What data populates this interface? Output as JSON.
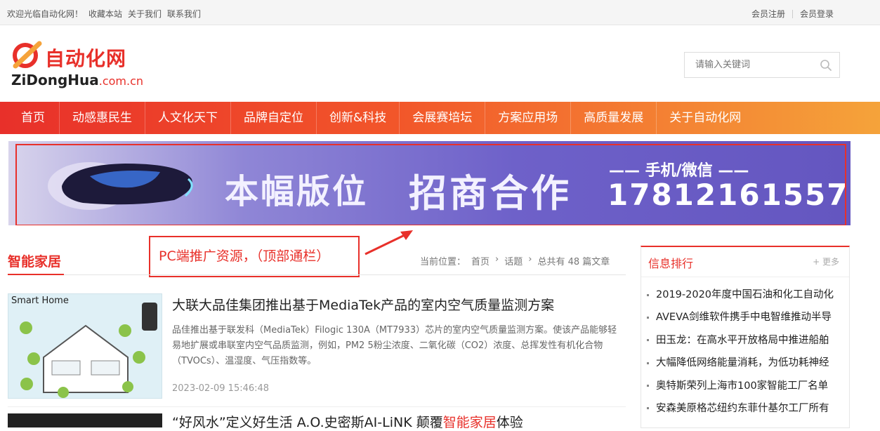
{
  "topbar": {
    "links": [
      "欢迎光临自动化网！",
      "收藏本站",
      "关于我们",
      "联系我们"
    ],
    "register": "会员注册",
    "login": "会员登录"
  },
  "logo": {
    "cn": "自动化网",
    "en": "ZiDongHua",
    "domain": ".com.cn"
  },
  "search": {
    "placeholder": "请输入关键词"
  },
  "nav": [
    "首页",
    "动感惠民生",
    "人文化天下",
    "品牌自定位",
    "创新&科技",
    "会展赛培坛",
    "方案应用场",
    "高质量发展",
    "关于自动化网"
  ],
  "banner": {
    "text1": "本幅版位",
    "text2": "招商合作",
    "text3": "—— 手机/微信 ——",
    "phone": "17812161557"
  },
  "annotation": "PC端推广资源，（顶部通栏）",
  "section": {
    "title": "智能家居",
    "crumbs": [
      "当前位置：",
      "首页",
      "›",
      "话题",
      "›",
      "总共有 48 篇文章"
    ]
  },
  "article": {
    "thumb_label": "Smart Home",
    "title": "大联大品佳集团推出基于MediaTek产品的室内空气质量监测方案",
    "desc": "品佳推出基于联发科（MediaTek）Filogic 130A（MT7933）芯片的室内空气质量监测方案。使该产品能够轻易地扩展或串联室内空气品质监测，例如，PM2 5粉尘浓度、二氧化碳（CO2）浓度、总挥发性有机化合物（TVOCs）、温湿度、气压指数等。",
    "time": "2023-02-09 15:46:48"
  },
  "article2": {
    "title_a": "“好风水”定义好生活 A.O.史密斯AI-LiNK 颠覆",
    "title_hl": "智能家居",
    "title_b": "体验"
  },
  "sidebar": {
    "title": "信息排行",
    "more": "+ 更多",
    "items": [
      "2019-2020年度中国石油和化工自动化",
      "AVEVA剑维软件携手中电智维推动半导",
      "田玉龙：在高水平开放格局中推进船舶",
      "大幅降低网络能量消耗，为低功耗神经",
      "奥特斯荣列上海市100家智能工厂名单",
      "安森美原格芯纽约东菲什基尔工厂所有"
    ]
  },
  "colors": {
    "accent": "#e8302a",
    "nav_end": "#f5a33a"
  }
}
